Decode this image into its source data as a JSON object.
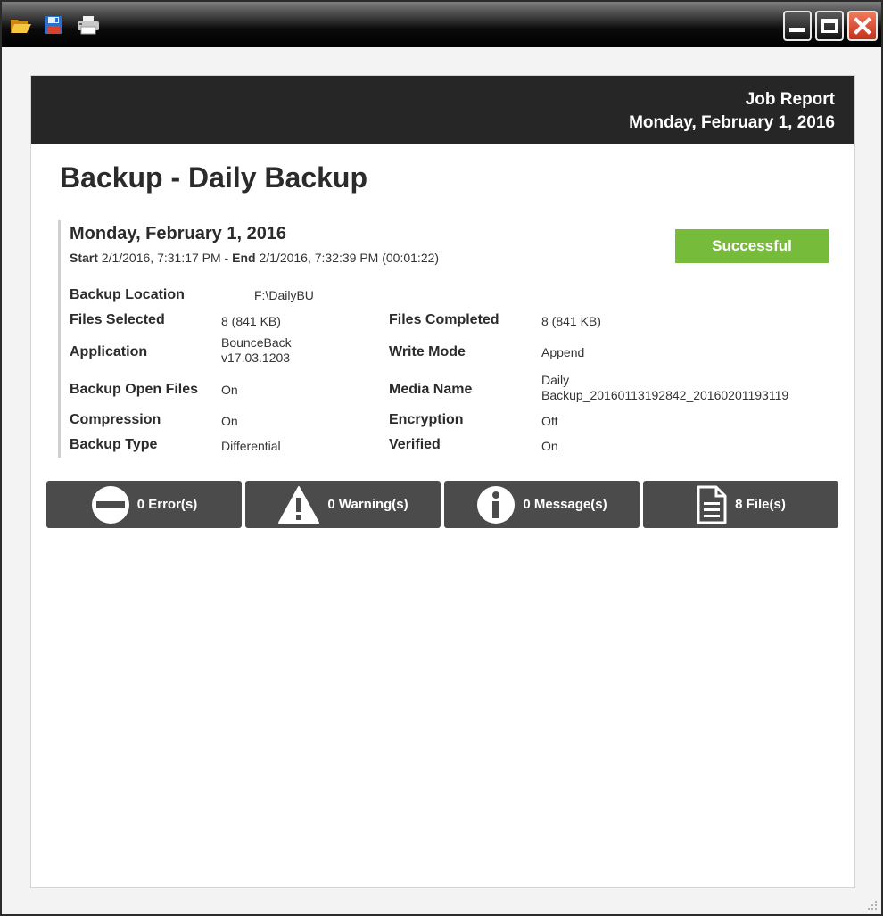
{
  "toolbar": {
    "open_icon": "folder-open-icon",
    "save_icon": "floppy-disk-icon",
    "print_icon": "printer-icon"
  },
  "window_controls": {
    "minimize_icon": "minimize-icon",
    "maximize_icon": "maximize-icon",
    "close_icon": "close-icon"
  },
  "header": {
    "title": "Job Report",
    "date": "Monday, February 1, 2016"
  },
  "job": {
    "title": "Backup - Daily Backup",
    "run_date": "Monday, February 1, 2016",
    "start_label": "Start",
    "start_value": " 2/1/2016, 7:31:17 PM - ",
    "end_label": "End",
    "end_value": " 2/1/2016, 7:32:39 PM (00:01:22)",
    "status": "Successful",
    "status_color": "#77bb3a"
  },
  "details": {
    "backup_location_label": "Backup Location",
    "backup_location_value": "F:\\DailyBU",
    "files_selected_label": "Files Selected",
    "files_selected_value": "8  (841 KB)",
    "files_completed_label": "Files Completed",
    "files_completed_value": "8  (841 KB)",
    "application_label": "Application",
    "application_value_line1": "BounceBack",
    "application_value_line2": "v17.03.1203",
    "write_mode_label": "Write Mode",
    "write_mode_value": "Append",
    "backup_open_files_label": "Backup Open Files",
    "backup_open_files_value": "On",
    "media_name_label": "Media Name",
    "media_name_value_line1": "Daily",
    "media_name_value_line2": "Backup_20160113192842_20160201193119",
    "compression_label": "Compression",
    "compression_value": "On",
    "encryption_label": "Encryption",
    "encryption_value": "Off",
    "backup_type_label": "Backup Type",
    "backup_type_value": "Differential",
    "verified_label": "Verified",
    "verified_value": "On"
  },
  "summary_tiles": [
    {
      "label": "0 Error(s)",
      "icon": "error-icon"
    },
    {
      "label": "0 Warning(s)",
      "icon": "warning-icon"
    },
    {
      "label": "0 Message(s)",
      "icon": "info-icon"
    },
    {
      "label": "8 File(s)",
      "icon": "file-icon"
    }
  ],
  "colors": {
    "header_bg": "#262626",
    "tile_bg": "#4b4b4b",
    "success": "#77bb3a",
    "close_button": "#d9442a"
  }
}
